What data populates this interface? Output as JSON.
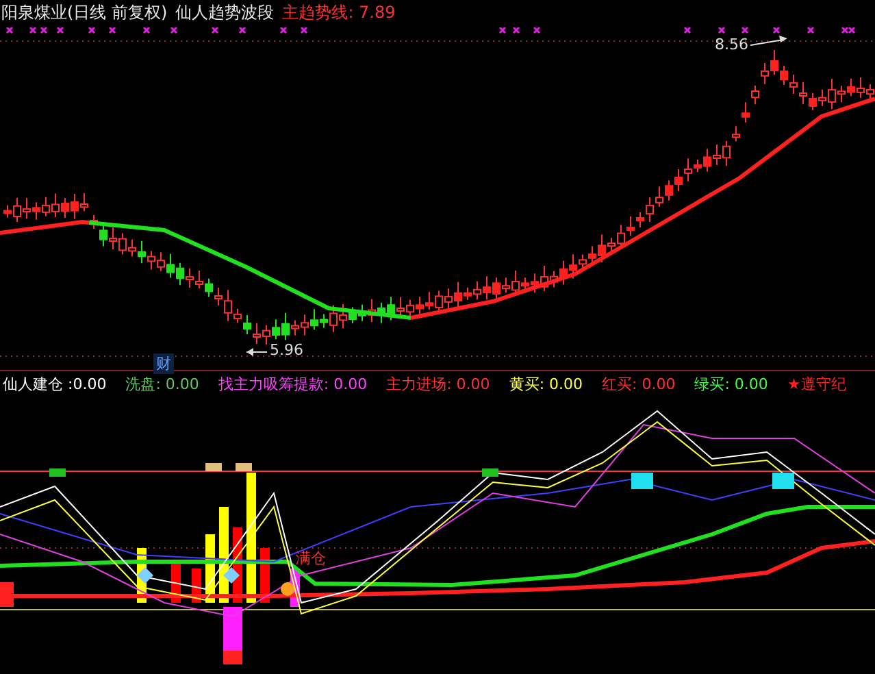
{
  "chart_header": {
    "stock": "阳泉煤业(日线 前复权)",
    "indicator": "仙人趋势波段",
    "trend": "主趋势线: 7.89"
  },
  "annotations": [
    {
      "kind": "high",
      "text": "8.56"
    },
    {
      "kind": "low",
      "text": "5.96"
    }
  ],
  "badge": "财",
  "indicator_legend": [
    {
      "text": "仙人建仓 :0.00",
      "color": "#ffffff"
    },
    {
      "text": "洗盘: 0.00",
      "color": "#5fc85f"
    },
    {
      "text": "找主力吸筹提款: 0.00",
      "color": "#ff40ff"
    },
    {
      "text": "主力进场: 0.00",
      "color": "#ff3030"
    },
    {
      "text": "黄买: 0.00",
      "color": "#ffff40"
    },
    {
      "text": "红买: 0.00",
      "color": "#ff3030"
    },
    {
      "text": "绿买: 0.00",
      "color": "#40ff40"
    },
    {
      "text": "★遵守纪",
      "color": "#ff2020"
    }
  ],
  "position_label": "满仓"
}
